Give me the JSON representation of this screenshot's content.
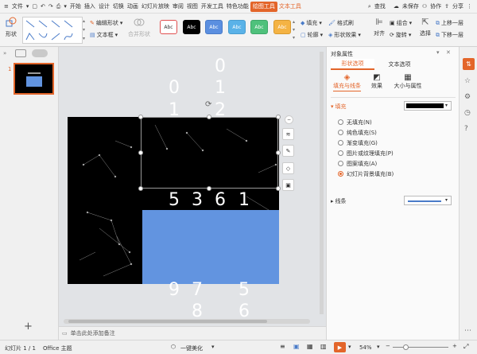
{
  "menubar": {
    "file": "文件",
    "tabs": [
      "开始",
      "插入",
      "设计",
      "切换",
      "动画",
      "幻灯片放映",
      "审阅",
      "视图",
      "开发工具",
      "特色功能"
    ],
    "active_tab": "绘图工具",
    "text_tool": "文本工具",
    "search": "查找",
    "unsaved": "未保存",
    "collaborate": "协作",
    "share": "分享"
  },
  "ribbon": {
    "shapes": "形状",
    "edit_shape": "编辑形状",
    "text_box": "文本框",
    "merge_shapes": "合并形状",
    "preset_text": "Abc",
    "fill": "填充",
    "format_painter": "格式刷",
    "outline": "轮廓",
    "shape_effect": "形状效果",
    "align": "对齐",
    "group": "组合",
    "rotate": "旋转",
    "select": "选择",
    "bring_forward": "上移一层",
    "send_backward": "下移一层",
    "presets": [
      {
        "bg": "#ffffff",
        "fg": "#333333",
        "border": "#e05050"
      },
      {
        "bg": "#000000",
        "fg": "#ffffff",
        "border": "#000000"
      },
      {
        "bg": "#5b8fe0",
        "fg": "#ffffff",
        "border": "#4a7bc8"
      },
      {
        "bg": "#5ab2e8",
        "fg": "#ffffff",
        "border": "#4a9dd0"
      },
      {
        "bg": "#4fc17c",
        "fg": "#ffffff",
        "border": "#3ea868"
      },
      {
        "bg": "#f4b344",
        "fg": "#ffffff",
        "border": "#d89a30"
      }
    ]
  },
  "leftpane": {
    "slide_number": "1"
  },
  "slide": {
    "digits_top": [
      "0",
      "1",
      "2"
    ],
    "digits_left": [
      "0",
      "1"
    ],
    "digits_main": [
      "5",
      "3",
      "6",
      "1"
    ],
    "digits_bottom": [
      "9",
      "7",
      "5",
      "8",
      "6"
    ],
    "blue": "#6294e0"
  },
  "notes": {
    "placeholder": "单击此处添加备注"
  },
  "panel": {
    "title": "对象属性",
    "tab_shape": "形状选项",
    "tab_text": "文本选项",
    "sub_fill_line": "填充与线条",
    "sub_effect": "效果",
    "sub_size": "大小与属性",
    "fill_section": "填充",
    "options": [
      {
        "label": "无填充(N)",
        "checked": false
      },
      {
        "label": "纯色填充(S)",
        "checked": false
      },
      {
        "label": "渐变填充(G)",
        "checked": false
      },
      {
        "label": "图片或纹理填充(P)",
        "checked": false
      },
      {
        "label": "图案填充(A)",
        "checked": false
      },
      {
        "label": "幻灯片背景填充(B)",
        "checked": true
      }
    ],
    "line_section": "线条"
  },
  "status": {
    "slide_info": "幻灯片 1 / 1",
    "theme": "Office 主题",
    "beautify": "一键美化",
    "zoom": "54%"
  },
  "colors": {
    "accent": "#e3652a"
  }
}
